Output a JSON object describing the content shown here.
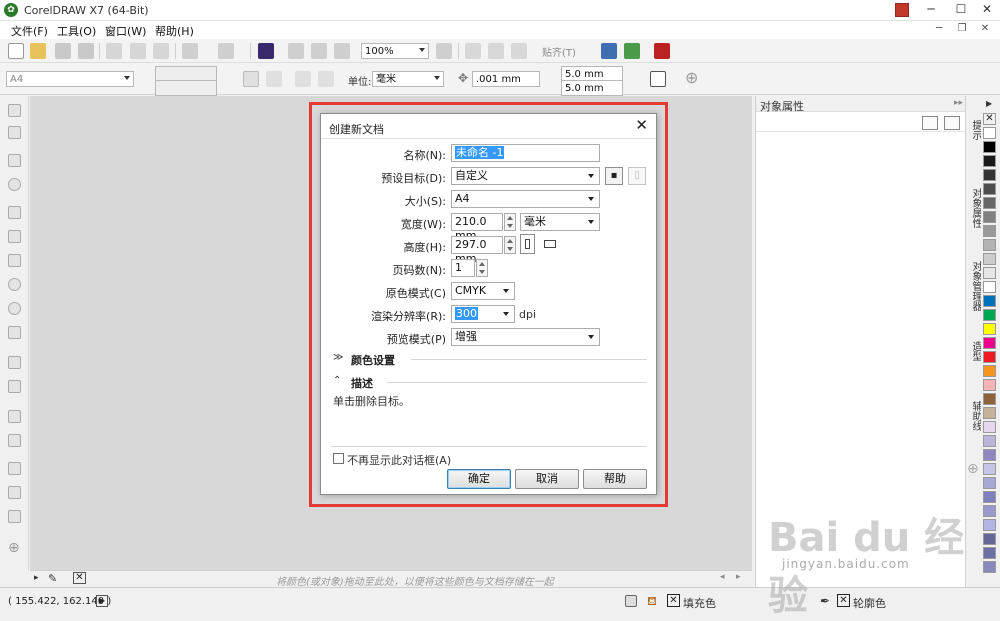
{
  "app": {
    "title": "CorelDRAW X7 (64-Bit)",
    "logo": "coreldraw-balloon-icon"
  },
  "menu": [
    "文件(F)",
    "工具(O)",
    "窗口(W)",
    "帮助(H)"
  ],
  "toolbar": {
    "zoom": "100%",
    "snap_label": "贴齐(T)"
  },
  "propbar": {
    "page_size": "A4",
    "unit_label": "单位:",
    "unit_value": "毫米",
    "nudge": ".001 mm",
    "dup_x": "5.0 mm",
    "dup_y": "5.0 mm"
  },
  "docker": {
    "title": "对象属性",
    "tabs": [
      "提示",
      "对象属性",
      "对象管理器",
      "造型",
      "辅助线"
    ]
  },
  "palette": {
    "colors": [
      "#ffffff",
      "#000000",
      "#1a1a1a",
      "#333333",
      "#4d4d4d",
      "#666666",
      "#808080",
      "#999999",
      "#b3b3b3",
      "#cccccc",
      "#e6e6e6",
      "#ffffff",
      "#0072bc",
      "#00a651",
      "#ffff00",
      "#ec008c",
      "#ed1c24",
      "#f7941d",
      "#f9b3b3",
      "#8c6239",
      "#c7b299",
      "#e6d7f0",
      "#bcb4d9",
      "#8f86c2",
      "#c5c5e8",
      "#a8a8d8",
      "#7f7fbf",
      "#9999cc",
      "#b3b3e6",
      "#666699",
      "#6f6fa8",
      "#8888bb"
    ]
  },
  "hint": "将颜色(或对象)拖动至此处，以便将这些颜色与文档存储在一起",
  "status": {
    "coords": "( 155.422, 162.140 )",
    "fill_label": "填充色",
    "outline_label": "轮廓色"
  },
  "dialog": {
    "title": "创建新文档",
    "name_label": "名称(N):",
    "name_value": "未命名 -1",
    "preset_label": "预设目标(D):",
    "preset_value": "自定义",
    "size_label": "大小(S):",
    "size_value": "A4",
    "width_label": "宽度(W):",
    "width_value": "210.0 mm",
    "width_unit": "毫米",
    "height_label": "高度(H):",
    "height_value": "297.0 mm",
    "pages_label": "页码数(N):",
    "pages_value": "1",
    "color_mode_label": "原色模式(C)",
    "color_mode_value": "CMYK",
    "resolution_label": "渲染分辨率(R):",
    "resolution_value": "300",
    "dpi": "dpi",
    "preview_label": "预览模式(P)",
    "preview_value": "增强",
    "color_settings": "颜色设置",
    "description": "描述",
    "description_text": "单击删除目标。",
    "dont_show": "不再显示此对话框(A)",
    "ok": "确定",
    "cancel": "取消",
    "help": "帮助"
  },
  "watermark": {
    "logo": "Bai du 经验",
    "url": "jingyan.baidu.com"
  }
}
